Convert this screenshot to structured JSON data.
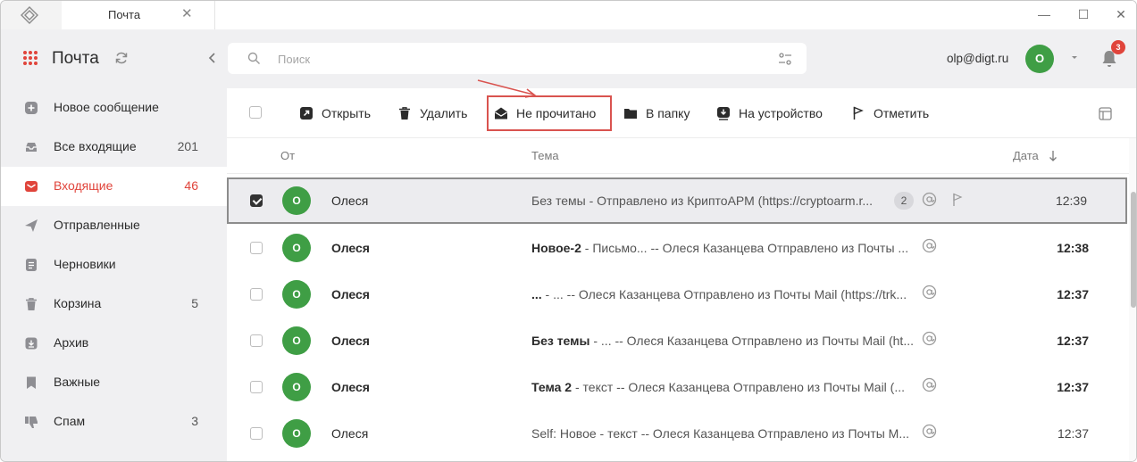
{
  "titlebar": {
    "tab_label": "Почта",
    "close_tab_glyph": "✕",
    "minimize_glyph": "—",
    "maximize_glyph": "☐",
    "close_glyph": "✕"
  },
  "sidebar": {
    "title": "Почта",
    "items": [
      {
        "label": "Новое сообщение",
        "count": "",
        "icon": "compose-icon"
      },
      {
        "label": "Все входящие",
        "count": "201",
        "icon": "all-inbox-icon"
      },
      {
        "label": "Входящие",
        "count": "46",
        "icon": "inbox-icon",
        "active": true
      },
      {
        "label": "Отправленные",
        "count": "",
        "icon": "send-icon"
      },
      {
        "label": "Черновики",
        "count": "",
        "icon": "drafts-icon"
      },
      {
        "label": "Корзина",
        "count": "5",
        "icon": "trash-icon"
      },
      {
        "label": "Архив",
        "count": "",
        "icon": "archive-icon"
      },
      {
        "label": "Важные",
        "count": "",
        "icon": "bookmark-icon"
      },
      {
        "label": "Спам",
        "count": "3",
        "icon": "spam-icon"
      }
    ]
  },
  "search": {
    "placeholder": "Поиск"
  },
  "account": {
    "email": "olp@digt.ru",
    "avatar_letter": "О",
    "notifications": "3"
  },
  "toolbar": {
    "open": "Открыть",
    "delete": "Удалить",
    "mark_unread": "Не прочитано",
    "to_folder": "В папку",
    "to_device": "На устройство",
    "flag": "Отметить"
  },
  "columns": {
    "from": "От",
    "subject": "Тема",
    "date": "Дата"
  },
  "messages": [
    {
      "letter": "О",
      "from": "Олеся",
      "subject_bold": "",
      "subject": "Без темы -  Отправлено из КриптоАРМ (https://cryptoarm.r...",
      "thread": "2",
      "time": "12:39",
      "selected": true,
      "unread": false
    },
    {
      "letter": "О",
      "from": "Олеся",
      "subject_bold": "Новое-2",
      "subject": " - Письмо... -- Олеся Казанцева Отправлено из Почты ...",
      "time": "12:38",
      "unread": true
    },
    {
      "letter": "О",
      "from": "Олеся",
      "subject_bold": "...",
      "subject": " - ... -- Олеся Казанцева Отправлено из Почты Mail (https://trk...",
      "time": "12:37",
      "unread": true
    },
    {
      "letter": "О",
      "from": "Олеся",
      "subject_bold": "Без темы",
      "subject": " - ... -- Олеся Казанцева Отправлено из Почты Mail (ht...",
      "time": "12:37",
      "unread": true
    },
    {
      "letter": "О",
      "from": "Олеся",
      "subject_bold": "Тема 2",
      "subject": " - текст -- Олеся Казанцева Отправлено из Почты Mail (...",
      "time": "12:37",
      "unread": true
    },
    {
      "letter": "О",
      "from": "Олеся",
      "subject_bold": "",
      "subject": "Self: Новое - текст -- Олеся Казанцева Отправлено из Почты М...",
      "time": "12:37",
      "unread": false
    }
  ],
  "colors": {
    "accent": "#e0443b",
    "avatar": "#3f9e45",
    "highlight": "#d9534f"
  }
}
